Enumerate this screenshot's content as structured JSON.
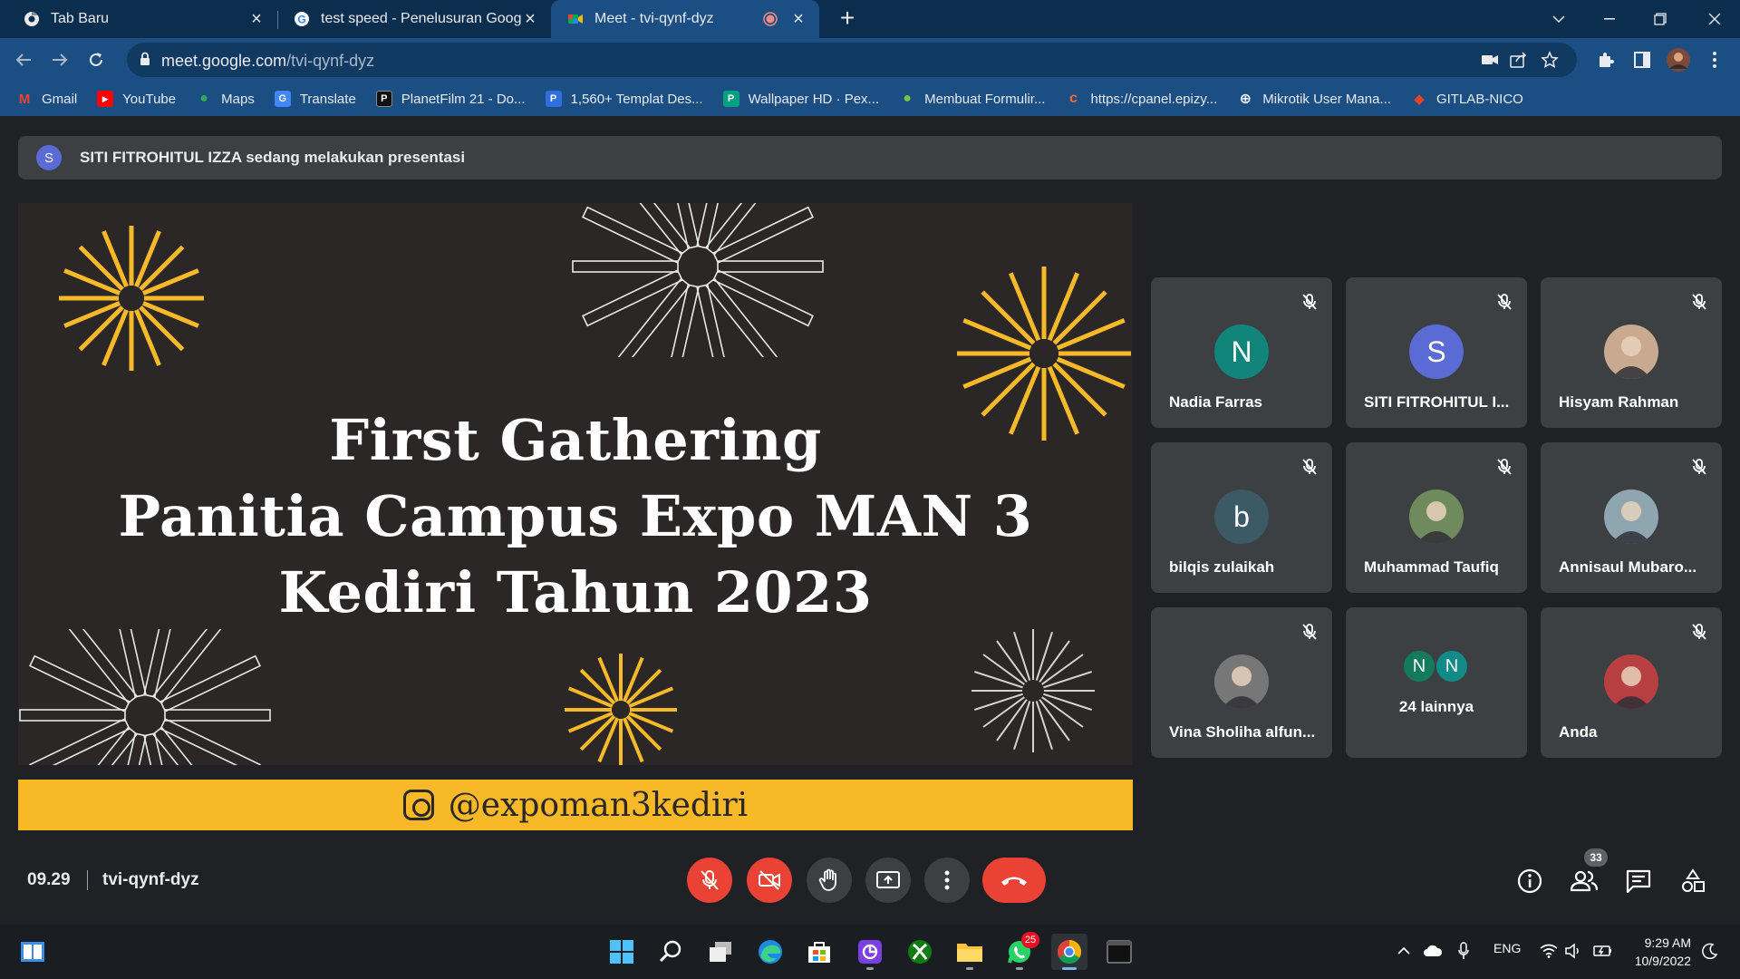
{
  "browser": {
    "tabs": [
      {
        "title": "Tab Baru",
        "icon": "chrome-icon"
      },
      {
        "title": "test speed - Penelusuran Google",
        "icon": "google-icon"
      },
      {
        "title": "Meet - tvi-qynf-dyz",
        "icon": "meet-icon"
      }
    ],
    "url_host": "meet.google.com",
    "url_path": "/tvi-qynf-dyz"
  },
  "bookmarks": [
    {
      "label": "Gmail",
      "color": "#ea4335",
      "glyph": "M"
    },
    {
      "label": "YouTube",
      "color": "#ff0000",
      "glyph": "▶"
    },
    {
      "label": "Maps",
      "color": "#34a853",
      "glyph": "●"
    },
    {
      "label": "Translate",
      "color": "#4285f4",
      "glyph": "G"
    },
    {
      "label": "PlanetFilm 21 - Do...",
      "color": "#111111",
      "glyph": "P"
    },
    {
      "label": "1,560+ Templat Des...",
      "color": "#2f6fdd",
      "glyph": "P"
    },
    {
      "label": "Wallpaper HD · Pex...",
      "color": "#05a081",
      "glyph": "P"
    },
    {
      "label": "Membuat Formulir...",
      "color": "#2da44e",
      "glyph": "●"
    },
    {
      "label": "https://cpanel.epizy...",
      "color": "#ff6c2c",
      "glyph": "c"
    },
    {
      "label": "Mikrotik User Mana...",
      "color": "#ffffff",
      "glyph": "⊕"
    },
    {
      "label": "GITLAB-NICO",
      "color": "#e24329",
      "glyph": "◆"
    }
  ],
  "meet": {
    "presenter_initial": "S",
    "presenter_banner": "SITI FITROHITUL IZZA sedang melakukan presentasi",
    "slide": {
      "line1": "First Gathering",
      "line2": "Panitia Campus Expo MAN 3",
      "line3": "Kediri Tahun 2023",
      "handle": "@expoman3kediri"
    },
    "participants": [
      {
        "name": "Nadia Farras",
        "initial": "N",
        "color": "#12857b",
        "type": "letter"
      },
      {
        "name": "SITI FITROHITUL I...",
        "initial": "S",
        "color": "#5b6bd6",
        "type": "letter"
      },
      {
        "name": "Hisyam Rahman",
        "initial": "",
        "color": "#c9a98f",
        "type": "photo"
      },
      {
        "name": "bilqis zulaikah",
        "initial": "b",
        "color": "#3c5a66",
        "type": "letter"
      },
      {
        "name": "Muhammad Taufiq",
        "initial": "",
        "color": "#6f8a5c",
        "type": "photo"
      },
      {
        "name": "Annisaul Mubaro...",
        "initial": "",
        "color": "#8fa5b0",
        "type": "photo"
      },
      {
        "name": "Vina Sholiha alfun...",
        "initial": "",
        "color": "#777777",
        "type": "photo"
      },
      {
        "name": "Anda",
        "initial": "",
        "color": "#b84040",
        "type": "photo"
      }
    ],
    "more": {
      "initials": [
        "N",
        "N"
      ],
      "label": "24 lainnya"
    },
    "time": "09.29",
    "meeting_code": "tvi-qynf-dyz",
    "people_count": "33"
  },
  "taskbar": {
    "notif_count": "25",
    "lang": "ENG",
    "time": "9:29 AM",
    "date": "10/9/2022"
  }
}
